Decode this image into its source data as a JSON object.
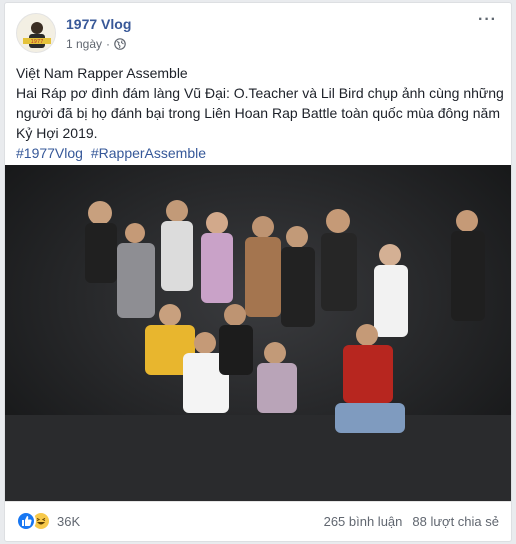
{
  "post": {
    "page_name": "1977 Vlog",
    "time": "1 ngày",
    "separator": "·",
    "privacy_icon": "globe-icon",
    "more_icon": "more-options-icon",
    "avatar_icon": "page-avatar-icon",
    "text_line_1": "Việt Nam Rapper Assemble",
    "text_line_2": "Hai Ráp pơ đình đám làng Vũ Đại: O.Teacher và Lil Bird chụp ảnh cùng những người đã bị họ đánh bại trong Liên Hoan Rap Battle toàn quốc mùa đông năm Kỷ Hợi 2019.",
    "hashtags": [
      "#1977Vlog",
      "#RapperAssemble"
    ]
  },
  "photo": {
    "subject": "group-photo-icon"
  },
  "footer": {
    "reactions": [
      "like-reaction-icon",
      "haha-reaction-icon"
    ],
    "reaction_count": "36K",
    "comments": "265 bình luận",
    "shares": "88 lượt chia sẻ"
  },
  "colors": {
    "link": "#385898",
    "hashtag": "#365899",
    "meta": "#616770",
    "photo_bg": "#1c1d1f"
  }
}
